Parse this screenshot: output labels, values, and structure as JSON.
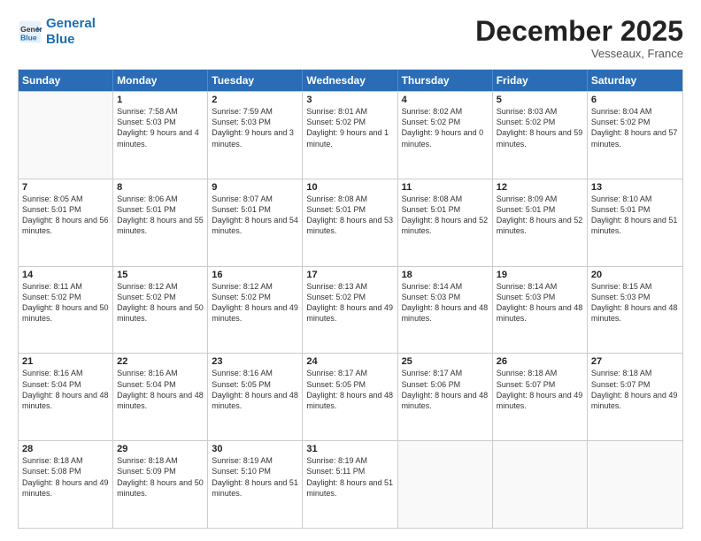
{
  "header": {
    "logo_line1": "General",
    "logo_line2": "Blue",
    "month": "December 2025",
    "location": "Vesseaux, France"
  },
  "days_of_week": [
    "Sunday",
    "Monday",
    "Tuesday",
    "Wednesday",
    "Thursday",
    "Friday",
    "Saturday"
  ],
  "weeks": [
    [
      {
        "day": "",
        "empty": true
      },
      {
        "day": "1",
        "sunrise": "7:58 AM",
        "sunset": "5:03 PM",
        "daylight": "9 hours and 4 minutes."
      },
      {
        "day": "2",
        "sunrise": "7:59 AM",
        "sunset": "5:03 PM",
        "daylight": "9 hours and 3 minutes."
      },
      {
        "day": "3",
        "sunrise": "8:01 AM",
        "sunset": "5:02 PM",
        "daylight": "9 hours and 1 minute."
      },
      {
        "day": "4",
        "sunrise": "8:02 AM",
        "sunset": "5:02 PM",
        "daylight": "9 hours and 0 minutes."
      },
      {
        "day": "5",
        "sunrise": "8:03 AM",
        "sunset": "5:02 PM",
        "daylight": "8 hours and 59 minutes."
      },
      {
        "day": "6",
        "sunrise": "8:04 AM",
        "sunset": "5:02 PM",
        "daylight": "8 hours and 57 minutes."
      }
    ],
    [
      {
        "day": "7",
        "sunrise": "8:05 AM",
        "sunset": "5:01 PM",
        "daylight": "8 hours and 56 minutes."
      },
      {
        "day": "8",
        "sunrise": "8:06 AM",
        "sunset": "5:01 PM",
        "daylight": "8 hours and 55 minutes."
      },
      {
        "day": "9",
        "sunrise": "8:07 AM",
        "sunset": "5:01 PM",
        "daylight": "8 hours and 54 minutes."
      },
      {
        "day": "10",
        "sunrise": "8:08 AM",
        "sunset": "5:01 PM",
        "daylight": "8 hours and 53 minutes."
      },
      {
        "day": "11",
        "sunrise": "8:08 AM",
        "sunset": "5:01 PM",
        "daylight": "8 hours and 52 minutes."
      },
      {
        "day": "12",
        "sunrise": "8:09 AM",
        "sunset": "5:01 PM",
        "daylight": "8 hours and 52 minutes."
      },
      {
        "day": "13",
        "sunrise": "8:10 AM",
        "sunset": "5:01 PM",
        "daylight": "8 hours and 51 minutes."
      }
    ],
    [
      {
        "day": "14",
        "sunrise": "8:11 AM",
        "sunset": "5:02 PM",
        "daylight": "8 hours and 50 minutes."
      },
      {
        "day": "15",
        "sunrise": "8:12 AM",
        "sunset": "5:02 PM",
        "daylight": "8 hours and 50 minutes."
      },
      {
        "day": "16",
        "sunrise": "8:12 AM",
        "sunset": "5:02 PM",
        "daylight": "8 hours and 49 minutes."
      },
      {
        "day": "17",
        "sunrise": "8:13 AM",
        "sunset": "5:02 PM",
        "daylight": "8 hours and 49 minutes."
      },
      {
        "day": "18",
        "sunrise": "8:14 AM",
        "sunset": "5:03 PM",
        "daylight": "8 hours and 48 minutes."
      },
      {
        "day": "19",
        "sunrise": "8:14 AM",
        "sunset": "5:03 PM",
        "daylight": "8 hours and 48 minutes."
      },
      {
        "day": "20",
        "sunrise": "8:15 AM",
        "sunset": "5:03 PM",
        "daylight": "8 hours and 48 minutes."
      }
    ],
    [
      {
        "day": "21",
        "sunrise": "8:16 AM",
        "sunset": "5:04 PM",
        "daylight": "8 hours and 48 minutes."
      },
      {
        "day": "22",
        "sunrise": "8:16 AM",
        "sunset": "5:04 PM",
        "daylight": "8 hours and 48 minutes."
      },
      {
        "day": "23",
        "sunrise": "8:16 AM",
        "sunset": "5:05 PM",
        "daylight": "8 hours and 48 minutes."
      },
      {
        "day": "24",
        "sunrise": "8:17 AM",
        "sunset": "5:05 PM",
        "daylight": "8 hours and 48 minutes."
      },
      {
        "day": "25",
        "sunrise": "8:17 AM",
        "sunset": "5:06 PM",
        "daylight": "8 hours and 48 minutes."
      },
      {
        "day": "26",
        "sunrise": "8:18 AM",
        "sunset": "5:07 PM",
        "daylight": "8 hours and 49 minutes."
      },
      {
        "day": "27",
        "sunrise": "8:18 AM",
        "sunset": "5:07 PM",
        "daylight": "8 hours and 49 minutes."
      }
    ],
    [
      {
        "day": "28",
        "sunrise": "8:18 AM",
        "sunset": "5:08 PM",
        "daylight": "8 hours and 49 minutes."
      },
      {
        "day": "29",
        "sunrise": "8:18 AM",
        "sunset": "5:09 PM",
        "daylight": "8 hours and 50 minutes."
      },
      {
        "day": "30",
        "sunrise": "8:19 AM",
        "sunset": "5:10 PM",
        "daylight": "8 hours and 51 minutes."
      },
      {
        "day": "31",
        "sunrise": "8:19 AM",
        "sunset": "5:11 PM",
        "daylight": "8 hours and 51 minutes."
      },
      {
        "day": "",
        "empty": true
      },
      {
        "day": "",
        "empty": true
      },
      {
        "day": "",
        "empty": true
      }
    ]
  ]
}
